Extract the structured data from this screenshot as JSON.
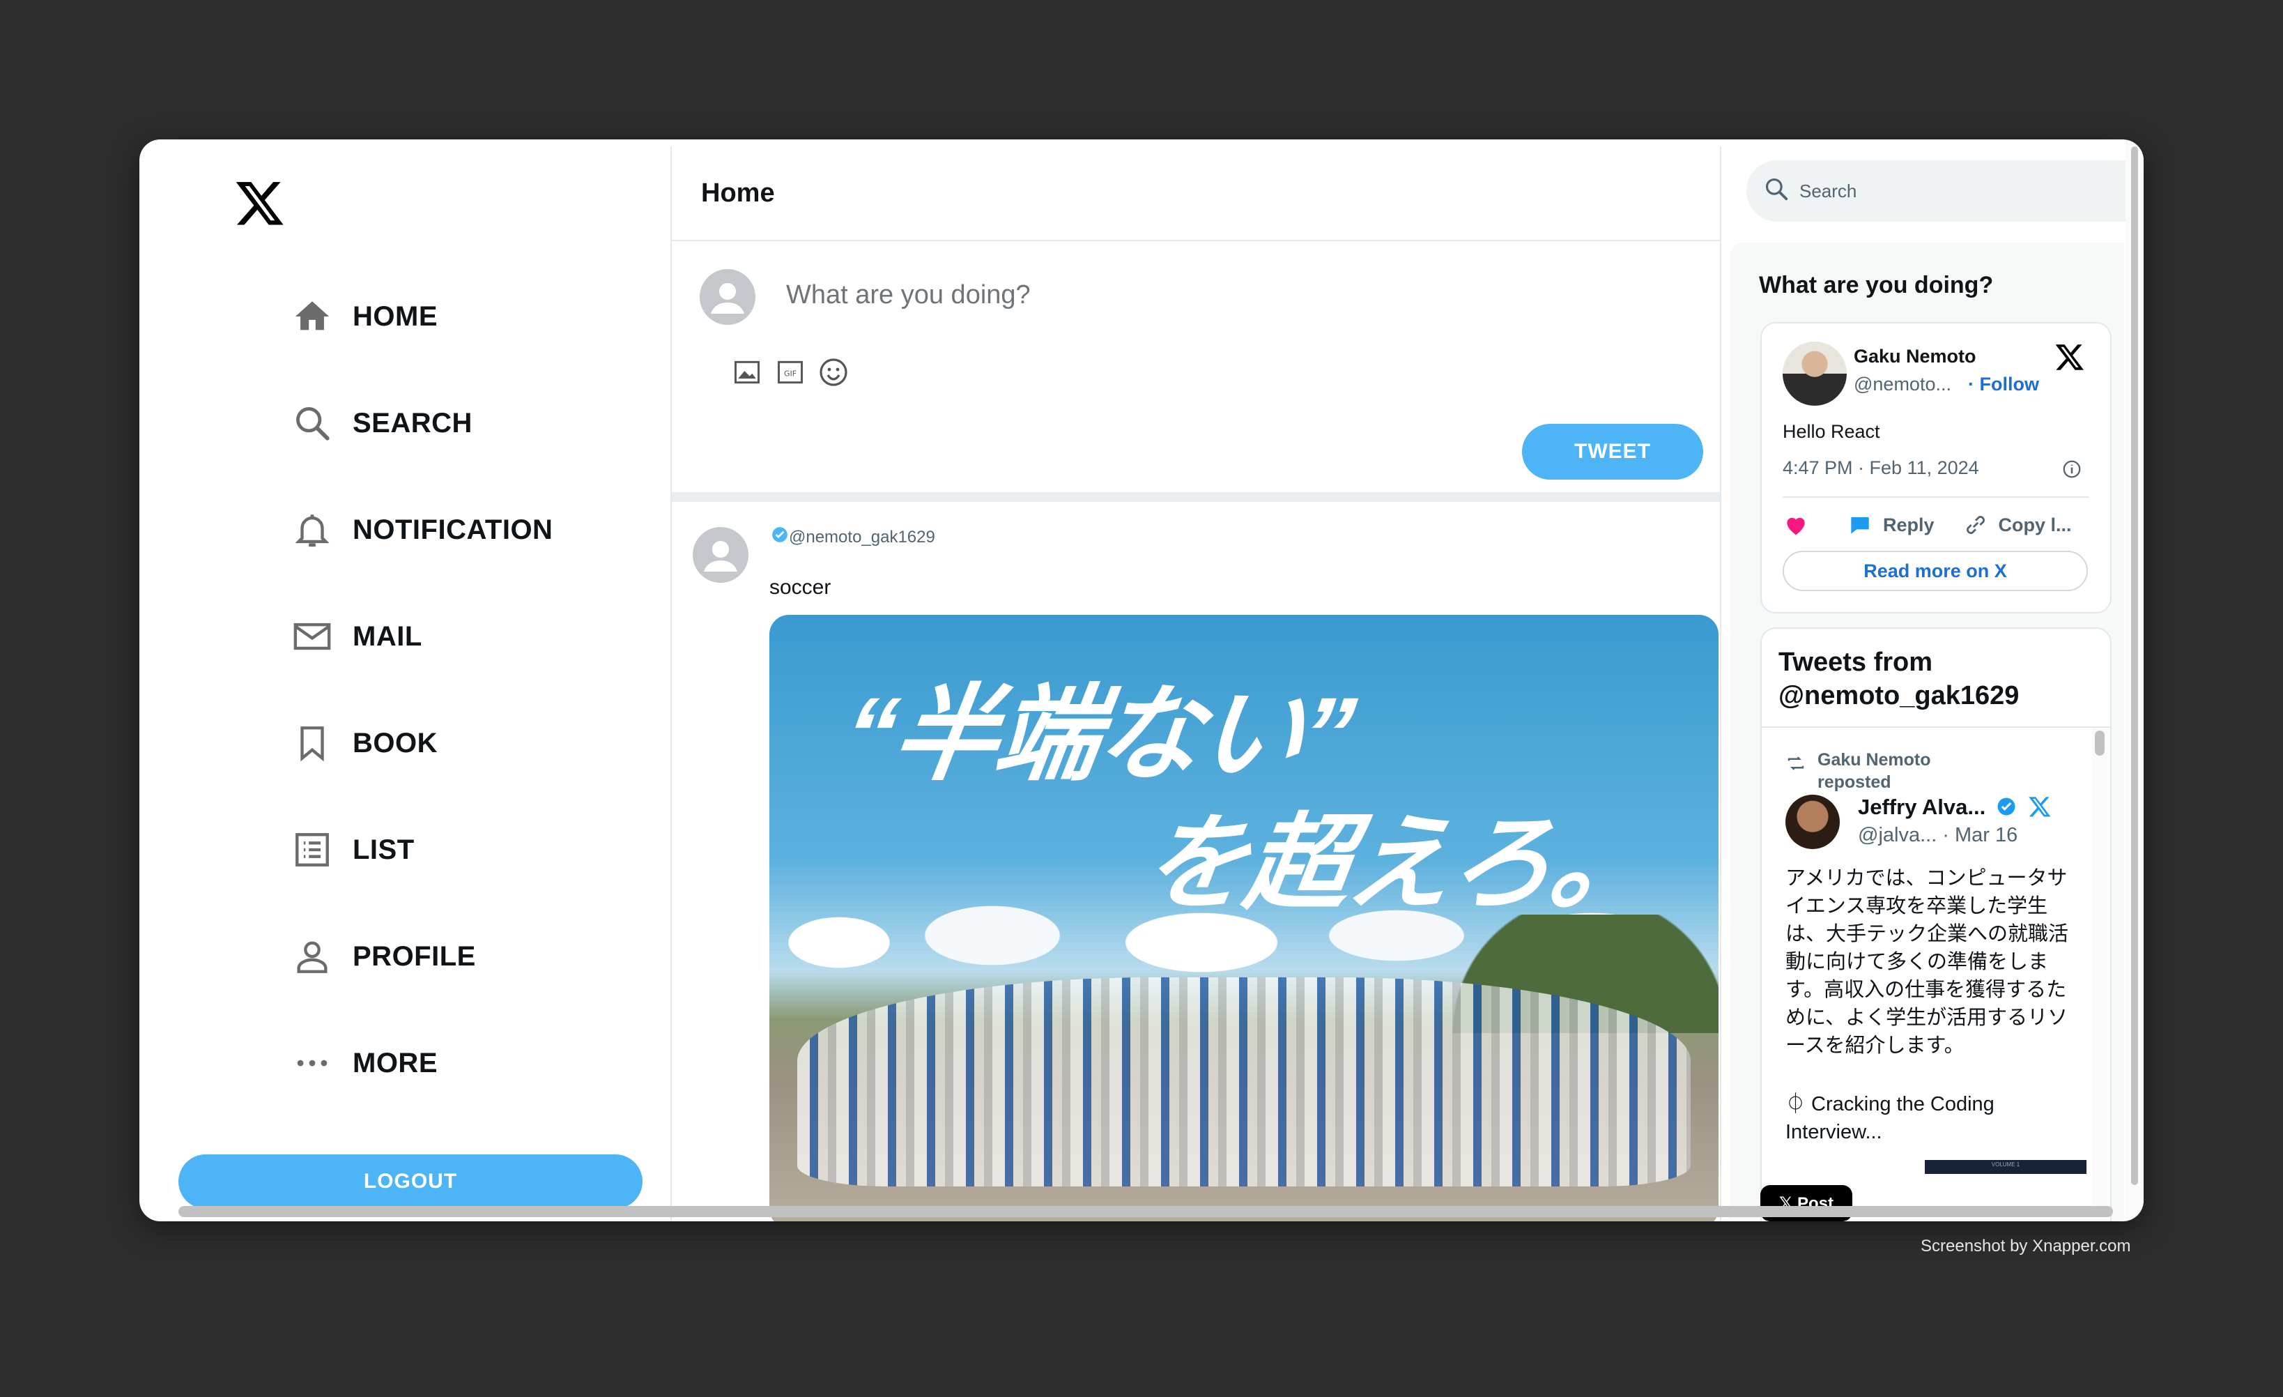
{
  "app": {
    "logo": "x-logo-icon",
    "accent_color": "#4db5f5",
    "link_color": "#1d6fd1"
  },
  "sidebar": {
    "items": [
      {
        "label": "HOME",
        "icon": "home-icon"
      },
      {
        "label": "SEARCH",
        "icon": "search-icon"
      },
      {
        "label": "NOTIFICATION",
        "icon": "bell-icon"
      },
      {
        "label": "MAIL",
        "icon": "mail-icon"
      },
      {
        "label": "BOOK",
        "icon": "bookmark-icon"
      },
      {
        "label": "LIST",
        "icon": "list-icon"
      },
      {
        "label": "PROFILE",
        "icon": "profile-icon"
      },
      {
        "label": "MORE",
        "icon": "more-icon"
      }
    ],
    "logout_label": "LOGOUT"
  },
  "main": {
    "title": "Home",
    "composer": {
      "placeholder": "What are you doing?",
      "tools": [
        "image-icon",
        "gif-icon",
        "emoji-icon"
      ],
      "tweet_label": "TWEET"
    },
    "post": {
      "handle": "@nemoto_gak1629",
      "verified": true,
      "text": "soccer",
      "image_title_line1": "“半端ない”",
      "image_title_line2": "を超えろ。"
    }
  },
  "right": {
    "search_placeholder": "Search",
    "heading": "What are you doing?",
    "embed": {
      "name": "Gaku Nemoto",
      "handle": "@nemoto...",
      "follow_label": "· Follow",
      "text": "Hello React",
      "timestamp": "4:47 PM · Feb 11, 2024",
      "actions": {
        "like": "",
        "reply": "Reply",
        "copy": "Copy l..."
      },
      "read_more": "Read more on X"
    },
    "timeline": {
      "title": "Tweets from @nemoto_gak1629",
      "repost_by": "Gaku Nemoto reposted",
      "author_name": "Jeffry Alva...",
      "author_meta": "@jalva... · Mar 16",
      "text": "アメリカでは、コンピュータサイエンス専攻を卒業した学生は、大手テック企業への就職活動に向けて多くの準備をします。高収入の仕事を獲得するために、よく学生が活用するリソースを紹介します。",
      "link_text": "⏀ Cracking the Coding Interview...",
      "thumb_text": "VOLUME 1"
    },
    "xpost_label": "𝕏 Post"
  },
  "footer": {
    "credit": "Screenshot by Xnapper.com"
  }
}
